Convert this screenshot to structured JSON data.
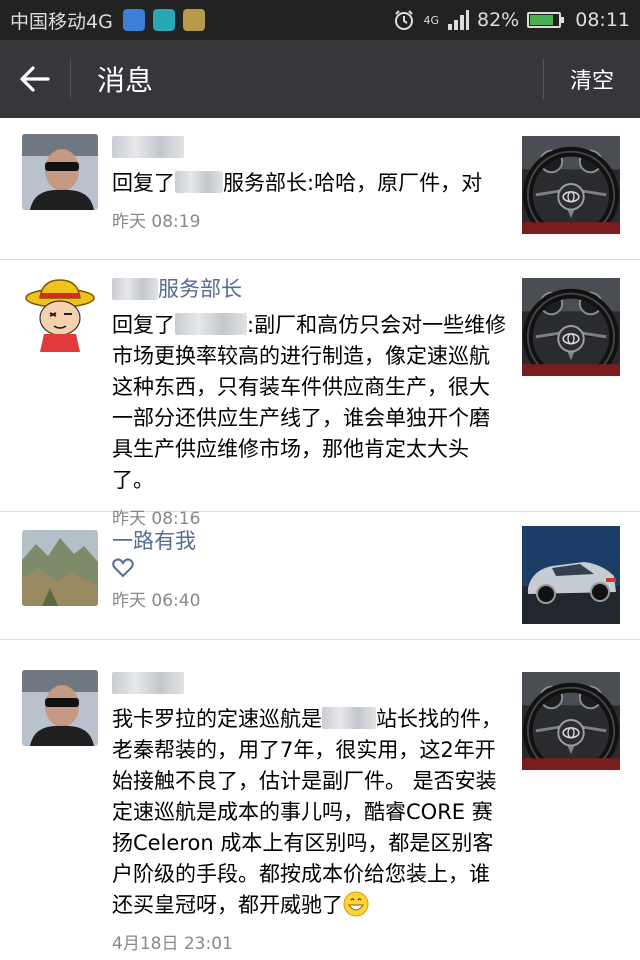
{
  "status_bar": {
    "carrier": "中国移动4G",
    "network": "4G",
    "battery": "82%",
    "battery_level": 0.82,
    "time": "08:11"
  },
  "app_bar": {
    "title": "消息",
    "clear_label": "清空"
  },
  "messages": [
    {
      "name": "",
      "content_prefix": "回复了",
      "content_suffix": "服务部长:哈哈，原厂件，对",
      "time": "昨天 08:19"
    },
    {
      "name": "服务部长",
      "content_prefix": "回复了",
      "content_suffix": ":副厂和高仿只会对一些维修市场更换率较高的进行制造，像定速巡航这种东西，只有装车件供应商生产，很大一部分还供应生产线了，谁会单独开个磨具生产供应维修市场，那他肯定太大头了。",
      "time": "昨天 08:16"
    },
    {
      "name": "一路有我",
      "time": "昨天 06:40",
      "icon": "heart-icon"
    },
    {
      "name": "",
      "content_prefix": "我卡罗拉的定速巡航是",
      "content_suffix": "站长找的件，老秦帮装的，用了7年，很实用，这2年开始接触不良了，估计是副厂件。 是否安装定速巡航是成本的事儿吗，酷睿CORE 赛扬Celeron 成本上有区别吗，都是区别客户阶级的手段。都按成本价给您装上，谁还买皇冠呀，都开威驰了",
      "emoji": "grin-emoji",
      "time": "4月18日 23:01"
    }
  ],
  "colors": {
    "status_bar_bg": "#222222",
    "app_bar_bg": "#35373b",
    "name_blue": "#576b95",
    "timestamp_gray": "#888888"
  }
}
